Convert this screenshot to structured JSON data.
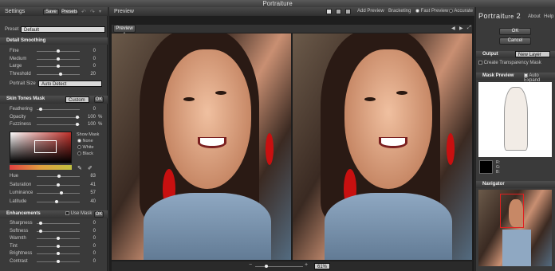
{
  "app_title": "Portraiture",
  "left": {
    "header": "Settings",
    "save": "Save",
    "presets": "Presets",
    "preset_label": "Preset",
    "preset_value": "Default",
    "detail": {
      "title": "Detail Smoothing",
      "rows": [
        {
          "label": "Fine",
          "value": "0",
          "pos": 0.5
        },
        {
          "label": "Medium",
          "value": "0",
          "pos": 0.5
        },
        {
          "label": "Large",
          "value": "0",
          "pos": 0.5
        },
        {
          "label": "Threshold",
          "value": "20",
          "pos": 0.55
        }
      ],
      "size_label": "Portrait Size",
      "size_value": "Auto Detect"
    },
    "skin": {
      "title": "Skin Tones Mask",
      "mode": "Custom",
      "ok": "OK",
      "rows": [
        {
          "label": "Feathering",
          "value": "0",
          "pos": 0.05,
          "pct": ""
        },
        {
          "label": "Opacity",
          "value": "100",
          "pos": 0.97,
          "pct": "%"
        },
        {
          "label": "Fuzziness",
          "value": "100",
          "pos": 0.97,
          "pct": "%"
        }
      ],
      "show_mask": "Show Mask",
      "options": [
        "None",
        "White",
        "Black"
      ],
      "hsl": [
        {
          "label": "Hue",
          "value": "83",
          "pos": 0.52
        },
        {
          "label": "Saturation",
          "value": "41",
          "pos": 0.5
        },
        {
          "label": "Luminance",
          "value": "57",
          "pos": 0.58
        },
        {
          "label": "Latitude",
          "value": "40",
          "pos": 0.45
        }
      ]
    },
    "enh": {
      "title": "Enhancements",
      "use_mask": "Use Mask",
      "ok": "OK",
      "rows": [
        {
          "label": "Sharpness",
          "value": "0",
          "pos": 0.05
        },
        {
          "label": "Softness",
          "value": "0",
          "pos": 0.05
        },
        {
          "label": "Warmth",
          "value": "0",
          "pos": 0.5
        },
        {
          "label": "Tint",
          "value": "0",
          "pos": 0.5
        },
        {
          "label": "Brightness",
          "value": "0",
          "pos": 0.5
        },
        {
          "label": "Contrast",
          "value": "0",
          "pos": 0.5
        }
      ]
    }
  },
  "mid": {
    "header": "Preview",
    "add_preview": "Add Preview",
    "bracketing": "Bracketing",
    "fast_preview": "Fast Preview",
    "accurate": "Accurate",
    "tab": "Preview 1",
    "zoom": "61%"
  },
  "right": {
    "brand_a": "Portrait",
    "brand_b": "ure",
    "brand_c": "2",
    "about": "About",
    "help": "Help",
    "ok": "OK",
    "cancel": "Cancel",
    "output_label": "Output",
    "output_value": "New Layer",
    "create_mask": "Create Transparency Mask",
    "mask_preview": "Mask Preview",
    "auto_expand": "Auto Expand",
    "rgb": [
      "R:",
      "G:",
      "B:"
    ],
    "navigator": "Navigator"
  }
}
